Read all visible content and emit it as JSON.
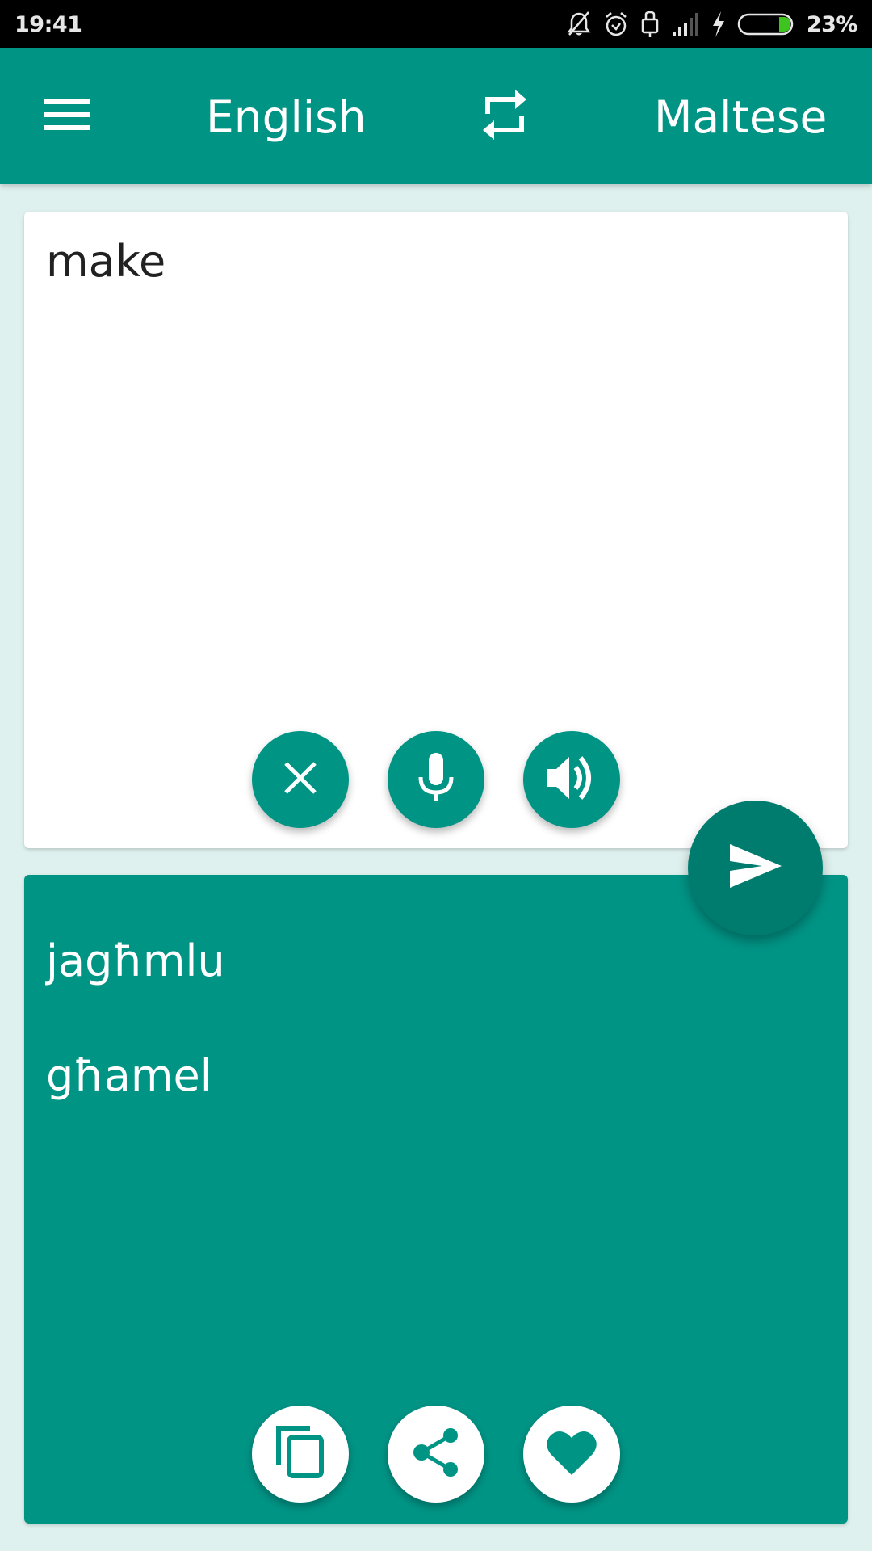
{
  "status_bar": {
    "time": "19:41",
    "battery_percent": "23%",
    "battery_level": 0.23,
    "battery_color": "#3ec41f",
    "icons": [
      "notifications-off-icon",
      "alarm-icon",
      "usb-lock-icon",
      "signal-icon",
      "charging-icon",
      "battery-icon"
    ]
  },
  "app_bar": {
    "menu_icon": "hamburger-menu-icon",
    "source_language": "English",
    "swap_icon": "swap-languages-icon",
    "target_language": "Maltese"
  },
  "input": {
    "text": "make",
    "actions": [
      {
        "name": "clear",
        "icon": "close-icon"
      },
      {
        "name": "voice-input",
        "icon": "microphone-icon"
      },
      {
        "name": "speak",
        "icon": "speaker-icon"
      }
    ]
  },
  "translate_button": {
    "icon": "send-icon"
  },
  "output": {
    "translations": [
      "jagħmlu",
      "għamel"
    ],
    "actions": [
      {
        "name": "copy",
        "icon": "copy-icon"
      },
      {
        "name": "share",
        "icon": "share-icon"
      },
      {
        "name": "favorite",
        "icon": "heart-icon"
      }
    ]
  },
  "colors": {
    "primary": "#009485",
    "primary_dark": "#007c6f",
    "background": "#dff1ee",
    "card": "#ffffff",
    "text_dark": "#212121",
    "text_light": "#ffffff"
  }
}
